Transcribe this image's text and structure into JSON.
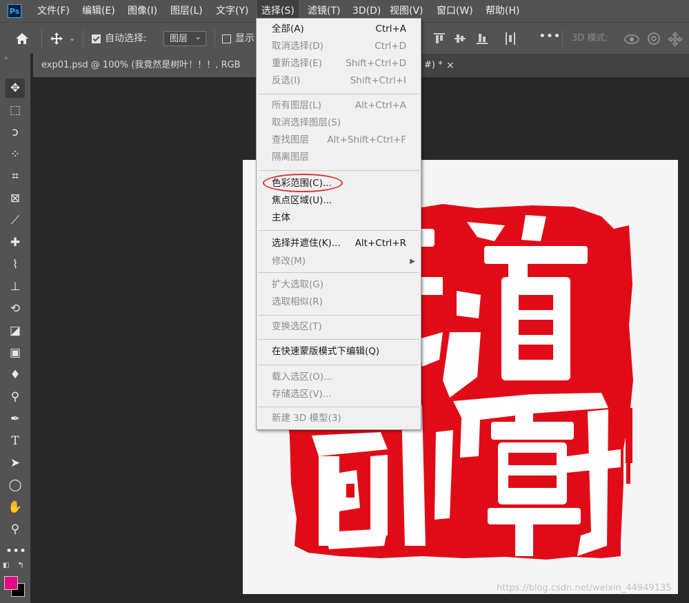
{
  "app": {
    "logo_text": "Ps"
  },
  "menubar": {
    "items": [
      {
        "label": "文件(F)"
      },
      {
        "label": "编辑(E)"
      },
      {
        "label": "图像(I)"
      },
      {
        "label": "图层(L)"
      },
      {
        "label": "文字(Y)"
      },
      {
        "label": "选择(S)"
      },
      {
        "label": "滤镜(T)"
      },
      {
        "label": "3D(D)"
      },
      {
        "label": "视图(V)"
      },
      {
        "label": "窗口(W)"
      },
      {
        "label": "帮助(H)"
      }
    ]
  },
  "options": {
    "auto_select_label": "自动选择:",
    "auto_select_checked": true,
    "auto_select_target": "图层",
    "show_label": "显示",
    "mode_3d_label": "3D 模式:"
  },
  "tab": {
    "title": "exp01.psd @ 100% (我竟然是树叶！！！, RGB",
    "title_tail": "#) *",
    "close": "×"
  },
  "select_menu": {
    "items": [
      {
        "label": "全部(A)",
        "shortcut": "Ctrl+A",
        "enabled": true
      },
      {
        "label": "取消选择(D)",
        "shortcut": "Ctrl+D",
        "enabled": false
      },
      {
        "label": "重新选择(E)",
        "shortcut": "Shift+Ctrl+D",
        "enabled": false
      },
      {
        "label": "反选(I)",
        "shortcut": "Shift+Ctrl+I",
        "enabled": false
      },
      {
        "label": "所有图层(L)",
        "shortcut": "Alt+Ctrl+A",
        "enabled": false
      },
      {
        "label": "取消选择图层(S)",
        "shortcut": "",
        "enabled": false
      },
      {
        "label": "查找图层",
        "shortcut": "Alt+Shift+Ctrl+F",
        "enabled": false
      },
      {
        "label": "隔离图层",
        "shortcut": "",
        "enabled": false
      },
      {
        "label": "色彩范围(C)...",
        "shortcut": "",
        "enabled": true,
        "highlighted": true
      },
      {
        "label": "焦点区域(U)...",
        "shortcut": "",
        "enabled": true
      },
      {
        "label": "主体",
        "shortcut": "",
        "enabled": true
      },
      {
        "label": "选择并遮住(K)...",
        "shortcut": "Alt+Ctrl+R",
        "enabled": true
      },
      {
        "label": "修改(M)",
        "shortcut": "",
        "enabled": false,
        "submenu": true
      },
      {
        "label": "扩大选取(G)",
        "shortcut": "",
        "enabled": false
      },
      {
        "label": "选取相似(R)",
        "shortcut": "",
        "enabled": false
      },
      {
        "label": "变换选区(T)",
        "shortcut": "",
        "enabled": false
      },
      {
        "label": "在快速蒙版模式下编辑(Q)",
        "shortcut": "",
        "enabled": true
      },
      {
        "label": "载入选区(O)...",
        "shortcut": "",
        "enabled": false
      },
      {
        "label": "存储选区(V)...",
        "shortcut": "",
        "enabled": false
      },
      {
        "label": "新建 3D 模型(3)",
        "shortcut": "",
        "enabled": false
      }
    ]
  },
  "canvas": {
    "seal_characters": [
      "天",
      "道",
      "酬",
      "勤"
    ],
    "seal_color": "#e10b17",
    "background_color": "#f5f5f5"
  },
  "colors": {
    "foreground": "#e20b84",
    "background": "#000000",
    "annotation_circle": "#e0322b"
  },
  "watermark": "https://blog.csdn.net/weixin_44949135"
}
